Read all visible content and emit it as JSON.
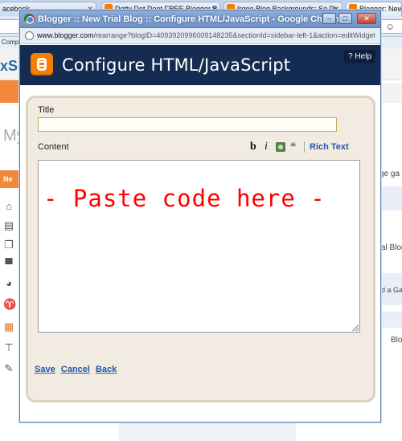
{
  "background": {
    "tabs": [
      {
        "label": "acebook"
      },
      {
        "label": "Dotty Dot Doot FREE Blogger B"
      },
      {
        "label": "Irene Blog Backgrounds: So Pr"
      },
      {
        "label": "Blogger: New T"
      }
    ],
    "toolbar_right_glyph": "☺",
    "bookmark_text": "Compa",
    "logo_text": "xSe",
    "page_heading_fragment": "My",
    "new_button_fragment": "Ne",
    "right_column_texts": [
      "ge ga",
      "al Blog",
      "d a Ga",
      "Blo"
    ]
  },
  "popup": {
    "window_title": "Blogger :: New Trial Blog :: Configure HTML/JavaScript - Google Chrome",
    "window_buttons": {
      "minimize": "–",
      "maximize": "□",
      "close": "✕"
    },
    "url_host": "www.blogger.com",
    "url_path": "/rearrange?blogID=4093920996009148235&sectionId=sidebar-left-1&action=editWidget&wid",
    "header_title": "Configure HTML/JavaScript",
    "help_label": "? Help",
    "form": {
      "title_label": "Title",
      "title_value": "",
      "content_label": "Content",
      "toolbar": {
        "bold": "b",
        "italic": "i",
        "quote": "❝",
        "rich_text": "Rich Text"
      },
      "code_text": "- Paste code here -",
      "actions": {
        "save": "Save",
        "cancel": "Cancel",
        "back": "Back"
      }
    }
  }
}
